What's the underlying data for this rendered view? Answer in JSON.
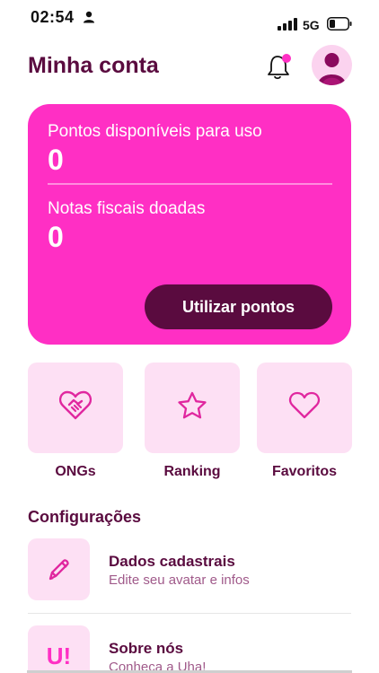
{
  "status": {
    "time": "02:54",
    "network": "5G"
  },
  "header": {
    "title": "Minha conta"
  },
  "points_card": {
    "available_label": "Pontos disponíveis para uso",
    "available_value": "0",
    "donated_label": "Notas fiscais doadas",
    "donated_value": "0",
    "button_label": "Utilizar pontos"
  },
  "shortcuts": [
    {
      "label": "ONGs",
      "icon": "heart-handshake-icon"
    },
    {
      "label": "Ranking",
      "icon": "star-icon"
    },
    {
      "label": "Favoritos",
      "icon": "heart-icon"
    }
  ],
  "settings": {
    "title": "Configurações",
    "items": [
      {
        "title": "Dados cadastrais",
        "subtitle": "Edite seu avatar e infos",
        "icon": "pencil-icon"
      },
      {
        "title": "Sobre nós",
        "subtitle": "Conheça a Uha!",
        "icon": "logo-u"
      }
    ],
    "logo_text": "U!"
  },
  "colors": {
    "accent": "#ff2fc4",
    "dark": "#5a0b3f",
    "tile": "#fde0f4"
  }
}
